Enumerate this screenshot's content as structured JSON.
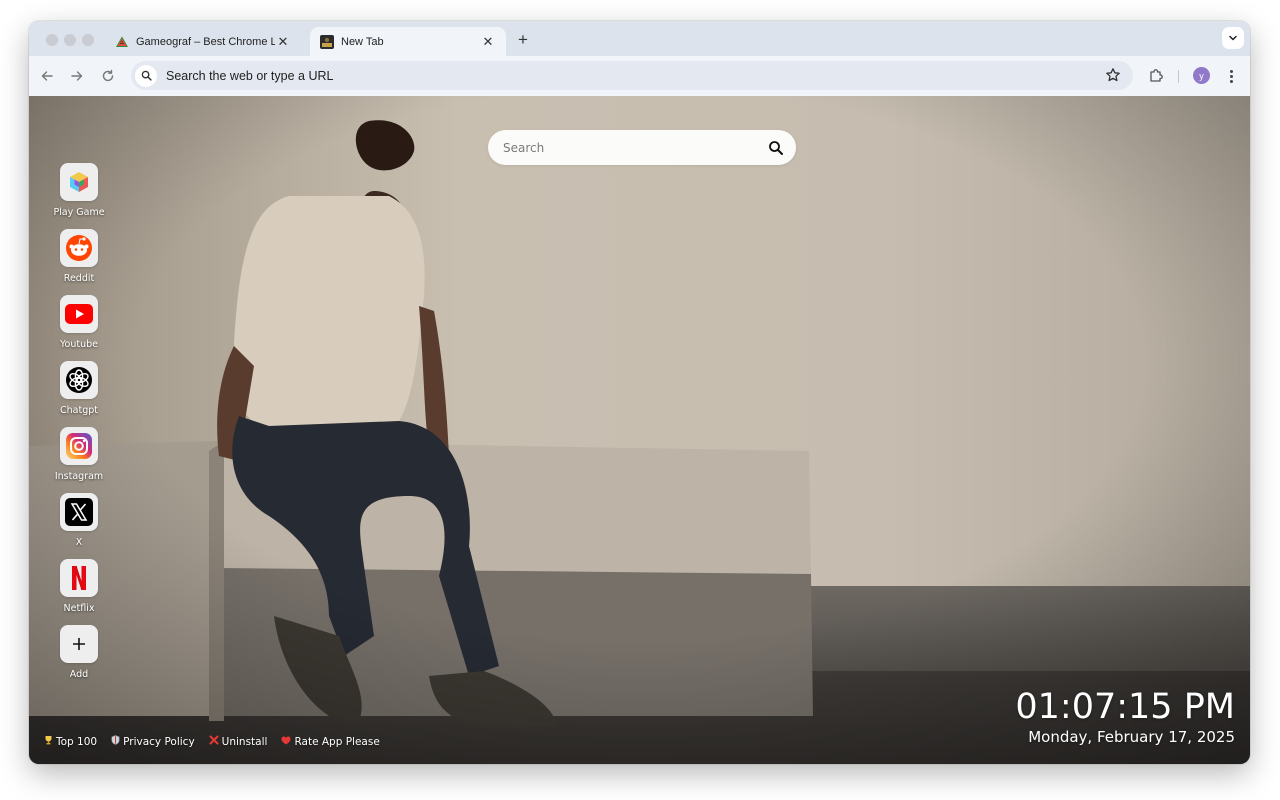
{
  "browser": {
    "tabs": [
      {
        "title": "Gameograf – Best Chrome Li",
        "favicon": "watermelon-icon"
      },
      {
        "title": "New Tab",
        "favicon": "gameograf-icon"
      }
    ],
    "omnibox_placeholder": "Search the web or type a URL",
    "avatar_initial": "y"
  },
  "search": {
    "placeholder": "Search"
  },
  "shortcuts": [
    {
      "label": "Play Game",
      "icon": "play-game-cube-icon"
    },
    {
      "label": "Reddit",
      "icon": "reddit-icon"
    },
    {
      "label": "Youtube",
      "icon": "youtube-icon"
    },
    {
      "label": "Chatgpt",
      "icon": "chatgpt-icon"
    },
    {
      "label": "Instagram",
      "icon": "instagram-icon"
    },
    {
      "label": "X",
      "icon": "x-icon"
    },
    {
      "label": "Netflix",
      "icon": "netflix-icon"
    },
    {
      "label": "Add",
      "icon": "plus-icon"
    }
  ],
  "clock": {
    "time": "01:07:15 PM",
    "date": "Monday, February 17, 2025"
  },
  "footer": [
    {
      "label": "Top 100",
      "icon": "trophy-icon"
    },
    {
      "label": "Privacy Policy",
      "icon": "shield-icon"
    },
    {
      "label": "Uninstall",
      "icon": "cross-icon"
    },
    {
      "label": "Rate App Please",
      "icon": "heart-icon"
    }
  ],
  "colors": {
    "accent": "#9079c8",
    "youtube": "#ff0000",
    "reddit": "#ff4500",
    "netflix": "#e50914"
  }
}
